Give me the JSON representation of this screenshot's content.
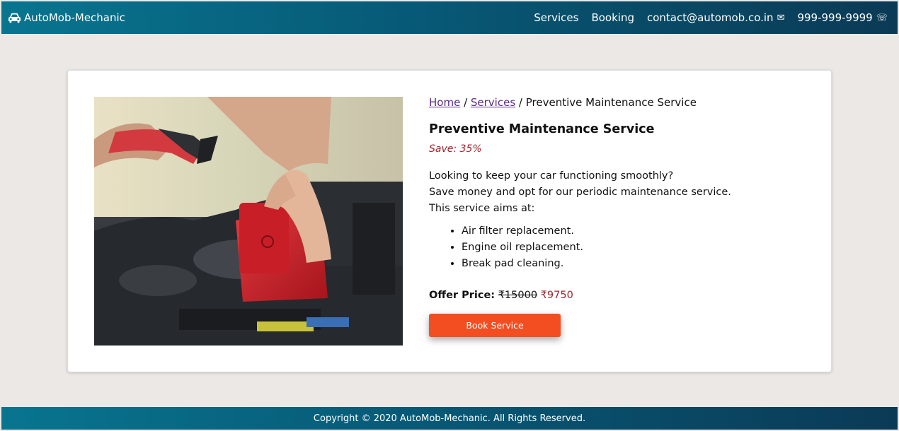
{
  "header": {
    "brand": "AutoMob-Mechanic",
    "brand_icon": "car-icon",
    "nav": {
      "services": "Services",
      "booking": "Booking",
      "email": "contact@automob.co.in",
      "email_icon": "✉",
      "phone": "999-999-9999",
      "phone_icon": "☏"
    }
  },
  "breadcrumb": {
    "home": "Home",
    "sep1": " / ",
    "services": "Services",
    "sep2": " / ",
    "current": "Preventive Maintenance Service"
  },
  "service": {
    "title": "Preventive Maintenance Service",
    "save": "Save: 35%",
    "description": [
      "Looking to keep your car functioning smoothly?",
      "Save money and opt for our periodic maintenance service.",
      "This service aims at:"
    ],
    "features": [
      "Air filter replacement.",
      "Engine oil replacement.",
      "Break pad cleaning."
    ],
    "price_label": "Offer Price:",
    "old_price": "₹15000",
    "new_price": "₹9750",
    "book_button": "Book Service"
  },
  "footer": {
    "copyright": "Copyright © 2020 AutoMob-Mechanic. All Rights Reserved."
  },
  "colors": {
    "nav_gradient_start": "#08758f",
    "nav_gradient_end": "#0b3a55",
    "button": "#f24e22",
    "accent_red": "#a0232e",
    "link_visited": "#5a2a8a",
    "page_bg": "#ece8e6"
  }
}
